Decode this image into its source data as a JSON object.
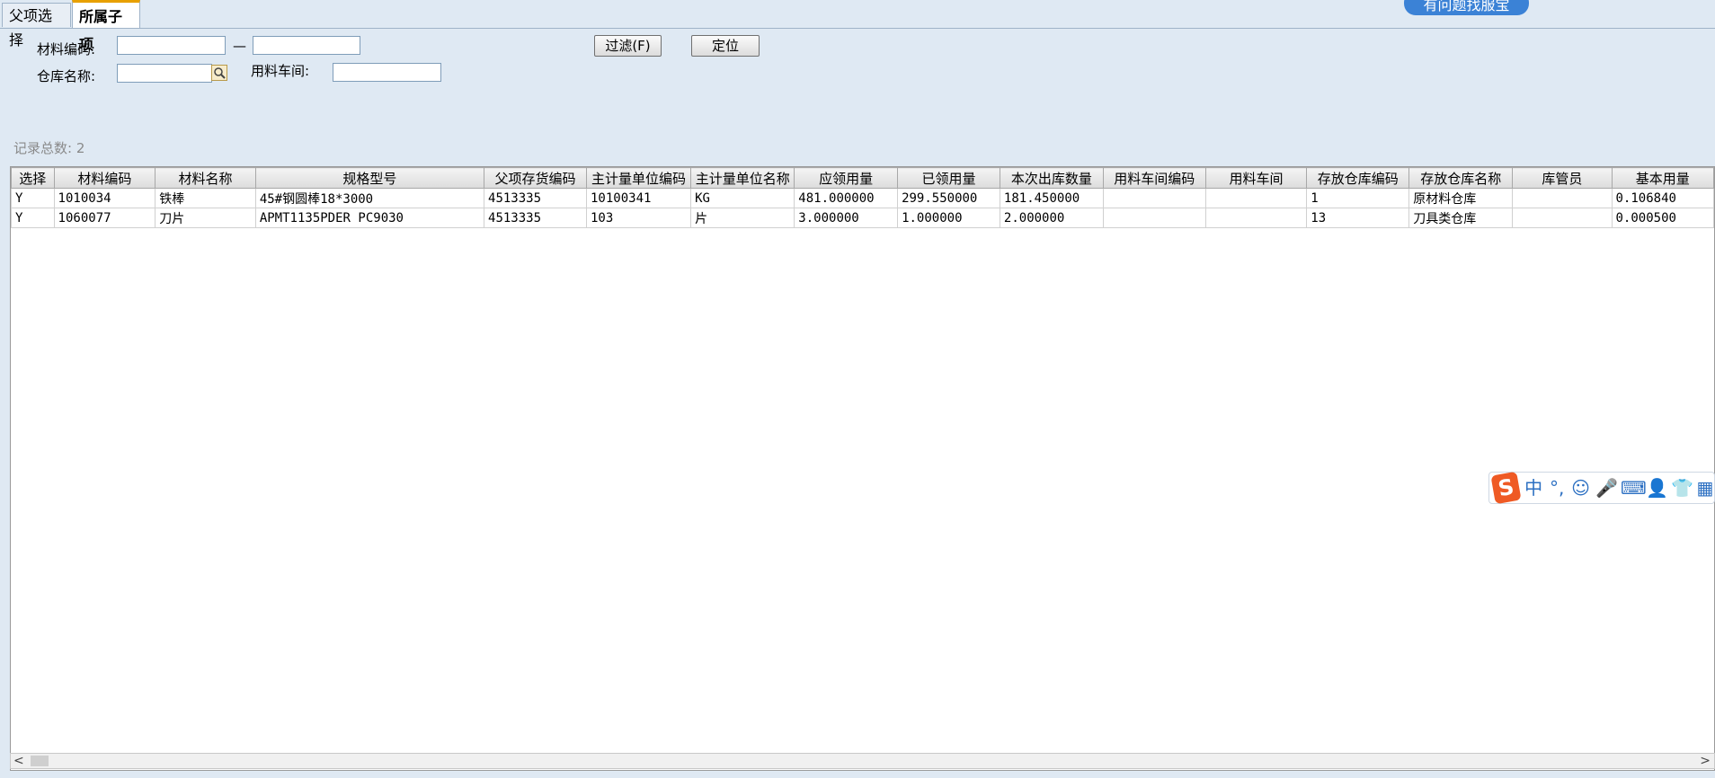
{
  "tabs": [
    "父项选择",
    "所属子项"
  ],
  "service_badge": "有问题找服宝",
  "filters": {
    "material_code_label": "材料编码:",
    "range_dash": "—",
    "warehouse_label": "仓库名称:",
    "workshop_label": "用料车间:",
    "material_code_from": "",
    "material_code_to": "",
    "warehouse_value": "",
    "workshop_value": ""
  },
  "buttons": {
    "filter": "过滤(F)",
    "locate": "定位"
  },
  "record_count": "记录总数: 2",
  "grid": {
    "columns": [
      "选择",
      "材料编码",
      "材料名称",
      "规格型号",
      "父项存货编码",
      "主计量单位编码",
      "主计量单位名称",
      "应领用量",
      "已领用量",
      "本次出库数量",
      "用料车间编码",
      "用料车间",
      "存放仓库编码",
      "存放仓库名称",
      "库管员",
      "基本用量"
    ],
    "rows": [
      [
        "Y",
        "1010034",
        "铁棒",
        "45#钢圆棒18*3000",
        "4513335",
        "10100341",
        "KG",
        "481.000000",
        "299.550000",
        "181.450000",
        "",
        "",
        "1",
        "原材料仓库",
        "",
        "0.106840"
      ],
      [
        "Y",
        "1060077",
        "刀片",
        "APMT1135PDER PC9030",
        "4513335",
        "103",
        "片",
        "3.000000",
        "1.000000",
        "2.000000",
        "",
        "",
        "13",
        "刀具类仓库",
        "",
        "0.000500"
      ]
    ]
  },
  "ime_toolbar": {
    "logo": "S",
    "mode": "中",
    "punct": "°,",
    "icons": [
      "emoji-icon",
      "mic-icon",
      "keyboard-icon",
      "user-icon",
      "skin-icon",
      "grid-icon"
    ]
  }
}
